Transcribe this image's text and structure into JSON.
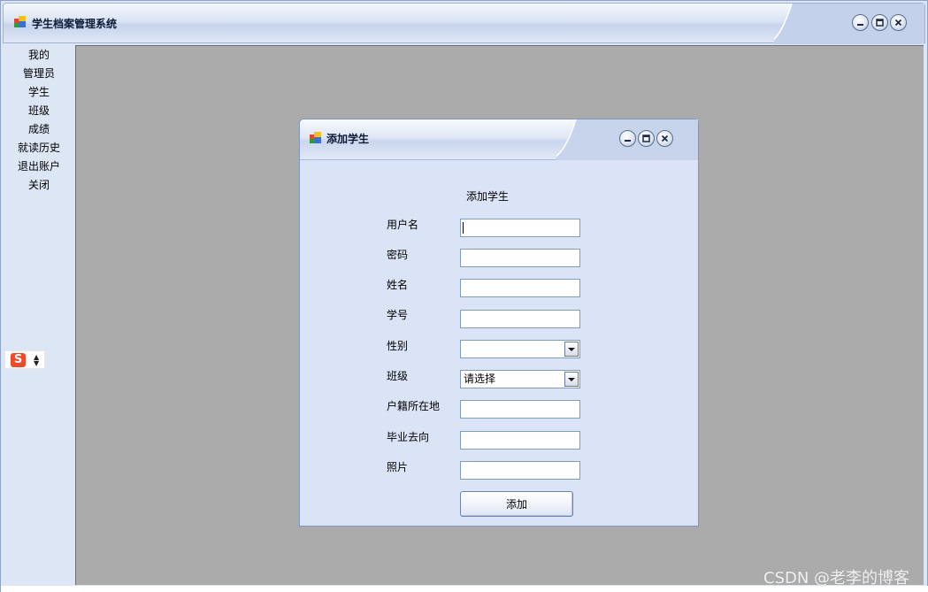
{
  "window": {
    "title": "学生档案管理系统",
    "icon": "app-window-icon"
  },
  "sidebar": {
    "items": [
      {
        "label": "我的"
      },
      {
        "label": "管理员"
      },
      {
        "label": "学生"
      },
      {
        "label": "班级"
      },
      {
        "label": "成绩"
      },
      {
        "label": "就读历史"
      },
      {
        "label": "退出账户"
      },
      {
        "label": "关闭"
      }
    ]
  },
  "ime": {
    "label": "S",
    "icon": "sogou-ime-icon"
  },
  "child_window": {
    "title": "添加学生",
    "form": {
      "heading": "添加学生",
      "fields": {
        "username": {
          "label": "用户名",
          "value": ""
        },
        "password": {
          "label": "密码",
          "value": ""
        },
        "name": {
          "label": "姓名",
          "value": ""
        },
        "student_id": {
          "label": "学号",
          "value": ""
        },
        "gender": {
          "label": "性别",
          "selected": ""
        },
        "class": {
          "label": "班级",
          "selected": "请选择"
        },
        "hometown": {
          "label": "户籍所在地",
          "value": ""
        },
        "graduation": {
          "label": "毕业去向",
          "value": ""
        },
        "photo": {
          "label": "照片",
          "value": ""
        }
      },
      "submit_label": "添加"
    }
  },
  "watermark": "CSDN @老李的博客",
  "colors": {
    "chrome": "#dde6f5",
    "mdi_background": "#ababab",
    "input_border": "#7f9db9"
  }
}
